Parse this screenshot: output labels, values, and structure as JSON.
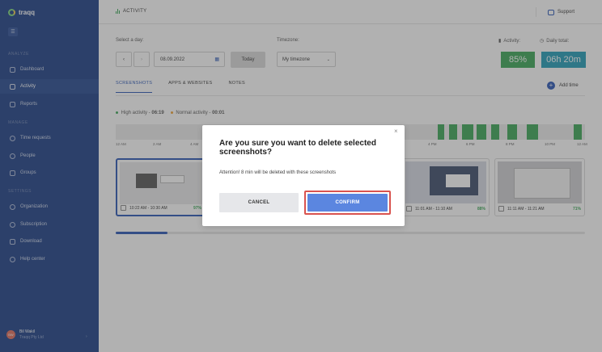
{
  "app": {
    "name": "traqq"
  },
  "sidebar": {
    "sections": {
      "analyze": "ANALYZE",
      "manage": "MANAGE",
      "settings": "SETTINGS"
    },
    "items": [
      {
        "label": "Dashboard",
        "icon": "dashboard-icon"
      },
      {
        "label": "Activity",
        "icon": "activity-icon",
        "active": true
      },
      {
        "label": "Reports",
        "icon": "reports-icon"
      },
      {
        "label": "Time requests",
        "icon": "clock-icon"
      },
      {
        "label": "People",
        "icon": "people-icon"
      },
      {
        "label": "Groups",
        "icon": "groups-icon"
      },
      {
        "label": "Organization",
        "icon": "gear-icon"
      },
      {
        "label": "Subscription",
        "icon": "subscription-icon"
      },
      {
        "label": "Download",
        "icon": "download-icon"
      },
      {
        "label": "Help center",
        "icon": "help-icon"
      }
    ],
    "user": {
      "initials": "BW",
      "name": "Bil Wakil",
      "company": "Traqq Pty Ltd"
    }
  },
  "header": {
    "title": "ACTIVITY",
    "support": "Support"
  },
  "filters": {
    "day_label": "Select a day:",
    "date_value": "08.09.2022",
    "today_button": "Today",
    "timezone_label": "Timezone:",
    "timezone_value": "My timezone"
  },
  "stats": {
    "activity_label": "Activity:",
    "activity_value": "85%",
    "activity_color": "#3aa655",
    "daily_total_label": "Daily total:",
    "daily_total_value": "06h 20m",
    "daily_total_color": "#1f9bb7"
  },
  "tabs": [
    {
      "label": "SCREENSHOTS",
      "active": true
    },
    {
      "label": "APPS & WEBSITES"
    },
    {
      "label": "NOTES"
    }
  ],
  "add_time": "Add time",
  "legend": {
    "high_label": "High activity",
    "high_value": "06:19",
    "high_color": "#3aa655",
    "normal_label": "Normal activity",
    "normal_value": "00:01",
    "normal_color": "#f0a030"
  },
  "timeline": {
    "ticks": [
      "12 AM",
      "2 AM",
      "4 AM",
      "4 PM",
      "6 PM",
      "8 PM",
      "10 PM",
      "12 AM"
    ]
  },
  "screenshots": [
    {
      "time": "10:22 AM - 10:30 AM",
      "activity": "97%",
      "selected": true
    },
    {
      "time": "11:01 AM - 11:10 AM",
      "activity": "88%"
    },
    {
      "time": "11:11 AM - 11:21 AM",
      "activity": "71%"
    }
  ],
  "modal": {
    "title": "Are you sure you want to delete selected screenshots?",
    "message": "Attention! 8 min will be deleted with these screenshots",
    "cancel": "CANCEL",
    "confirm": "CONFIRM"
  }
}
